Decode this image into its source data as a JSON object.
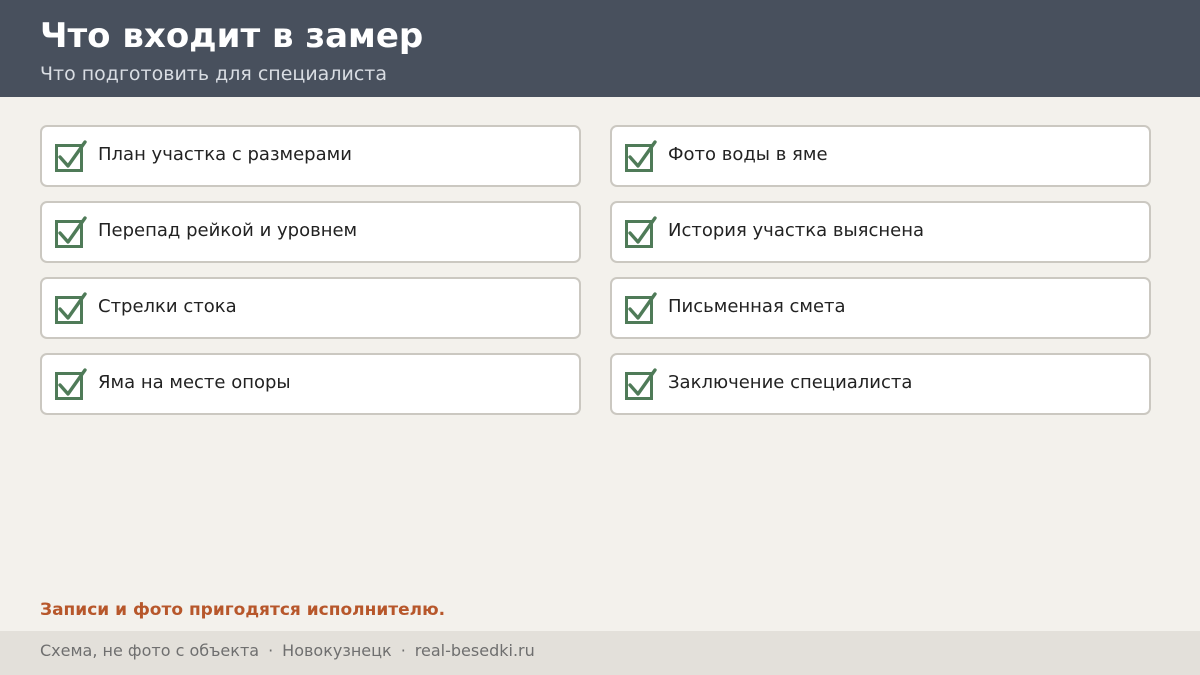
{
  "header": {
    "title": "Что входит в замер",
    "subtitle": "Что подготовить для специалиста"
  },
  "checklist": {
    "items": [
      {
        "label": "План участка с размерами",
        "checked": true
      },
      {
        "label": "Перепад рейкой и уровнем",
        "checked": true
      },
      {
        "label": "Стрелки стока",
        "checked": true
      },
      {
        "label": "Яма на месте опоры",
        "checked": true
      },
      {
        "label": "Фото воды в яме",
        "checked": true
      },
      {
        "label": "История участка выяснена",
        "checked": true
      },
      {
        "label": "Письменная смета",
        "checked": true
      },
      {
        "label": "Заключение специалиста",
        "checked": true
      }
    ]
  },
  "note": "Записи и фото пригодятся исполнителю.",
  "footer": {
    "parts": [
      "Схема, не фото с объекта",
      "Новокузнецк",
      "real-besedki.ru"
    ],
    "separator": "·"
  },
  "colors": {
    "header_bg": "#48505d",
    "page_bg": "#f3f1ec",
    "check_green": "#4f7b58",
    "note_orange": "#b7572b",
    "footer_bg": "#e3e0da"
  },
  "icons": {
    "check": "checkmark-icon"
  }
}
